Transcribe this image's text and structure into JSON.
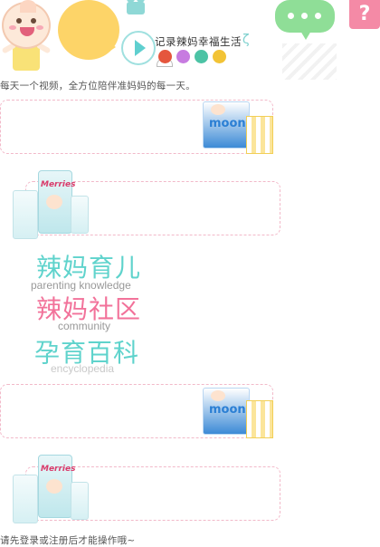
{
  "header": {
    "tagline": "记录辣妈幸福生活",
    "tagline_wave": "ζ",
    "help_label": "?",
    "subtitle": "每天一个视频，全方位陪伴准妈妈的每一天。",
    "social_icons": [
      {
        "name": "weibo-icon",
        "color": "#e5563d"
      },
      {
        "name": "heart-icon",
        "color": "#c77be0"
      },
      {
        "name": "wechat-icon",
        "color": "#4cc3a5"
      },
      {
        "name": "qzone-icon",
        "color": "#f2c336"
      }
    ]
  },
  "promos": [
    {
      "brand": "moony",
      "layout": "right"
    },
    {
      "brand": "Merries",
      "layout": "left"
    },
    {
      "brand": "moony",
      "layout": "right"
    },
    {
      "brand": "Merries",
      "layout": "left"
    }
  ],
  "nav": [
    {
      "title": "辣妈育儿",
      "subtitle": "parenting knowledge",
      "title_color": "#5fd3cc",
      "subtitle_color": "#999999"
    },
    {
      "title": "辣妈社区",
      "subtitle": "community",
      "title_color": "#f2729a",
      "subtitle_color": "#999999"
    },
    {
      "title": "孕育百科",
      "subtitle": "encyclopedia",
      "title_color": "#5fd3cc",
      "subtitle_color": "#c9c9c9"
    }
  ],
  "footer": {
    "text": "请先登录或注册后才能操作哦~"
  },
  "colors": {
    "accent_teal": "#5fd3cc",
    "accent_pink": "#f2729a",
    "bubble_yellow": "#fdd468",
    "bubble_green": "#8fde97",
    "help_pink": "#f48aa6"
  }
}
